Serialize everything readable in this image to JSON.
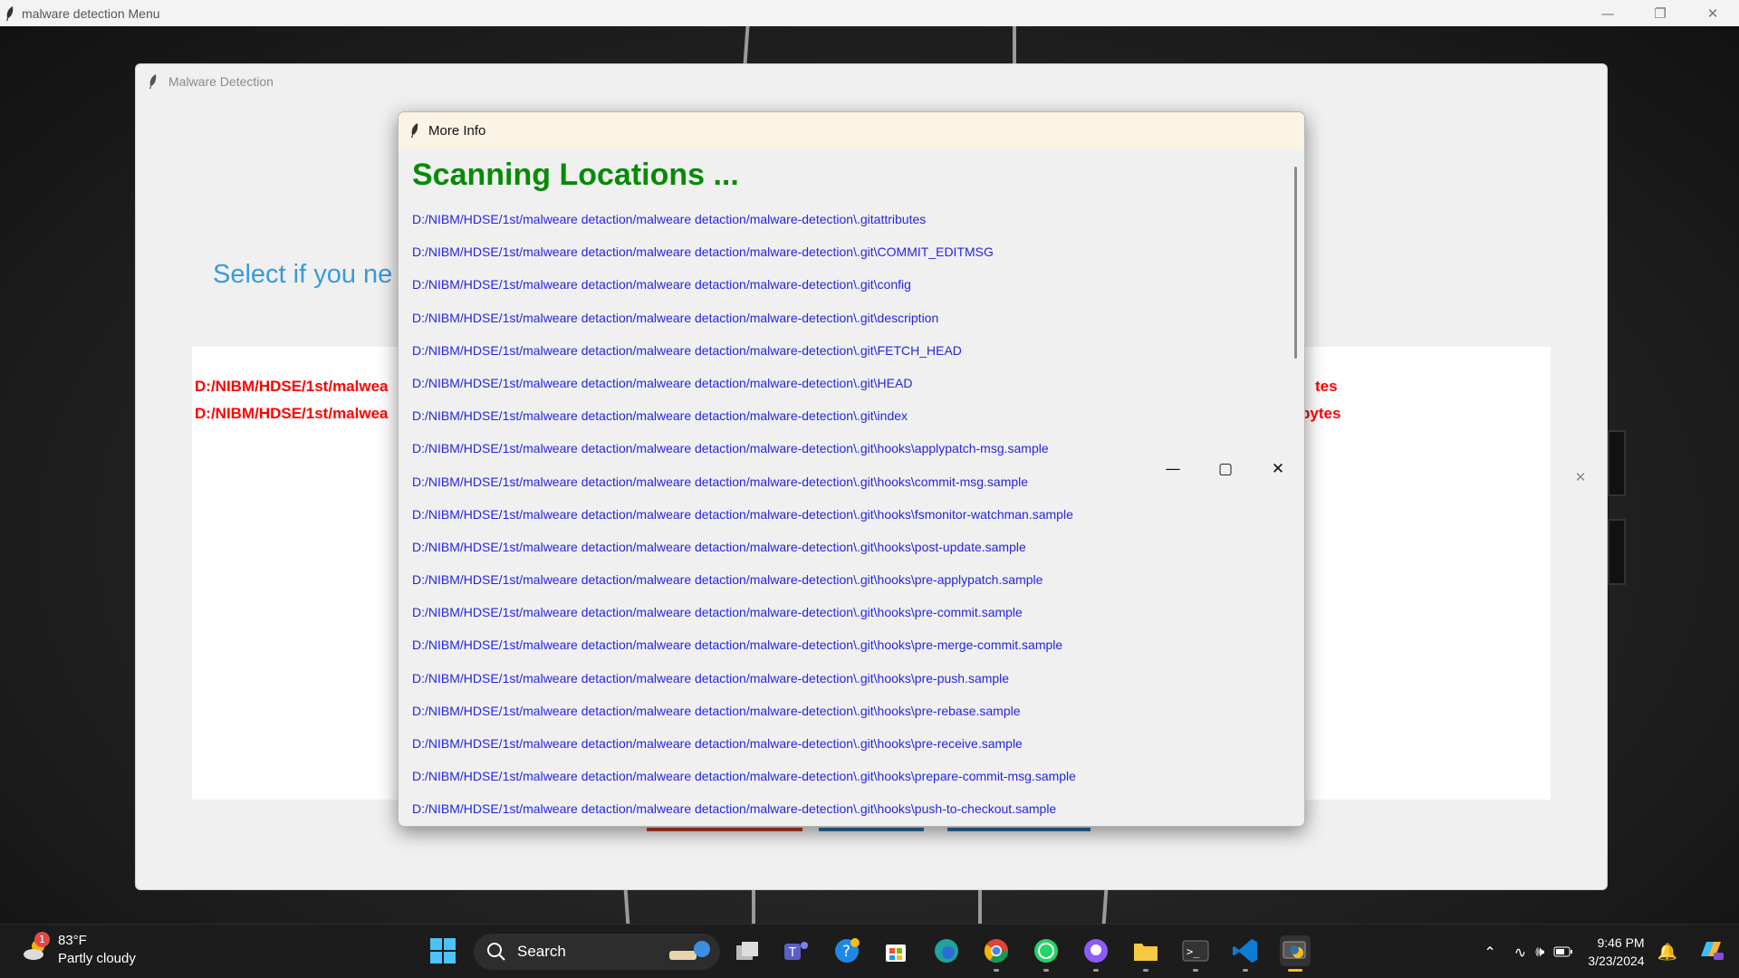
{
  "menu_window": {
    "title": "malware detection Menu"
  },
  "detection_window": {
    "title": "Malware Detection",
    "select_label": "Select if you ne",
    "results": [
      {
        "left": "D:/NIBM/HDSE/1st/malwea",
        "right": "tes"
      },
      {
        "left": "D:/NIBM/HDSE/1st/malwea",
        "right": "bytes"
      }
    ]
  },
  "info_window": {
    "title": "More Info",
    "heading": "Scanning Locations ...",
    "locations": [
      "D:/NIBM/HDSE/1st/malweare detaction/malweare detaction/malware-detection\\.gitattributes",
      "D:/NIBM/HDSE/1st/malweare detaction/malweare detaction/malware-detection\\.git\\COMMIT_EDITMSG",
      "D:/NIBM/HDSE/1st/malweare detaction/malweare detaction/malware-detection\\.git\\config",
      "D:/NIBM/HDSE/1st/malweare detaction/malweare detaction/malware-detection\\.git\\description",
      "D:/NIBM/HDSE/1st/malweare detaction/malweare detaction/malware-detection\\.git\\FETCH_HEAD",
      "D:/NIBM/HDSE/1st/malweare detaction/malweare detaction/malware-detection\\.git\\HEAD",
      "D:/NIBM/HDSE/1st/malweare detaction/malweare detaction/malware-detection\\.git\\index",
      "D:/NIBM/HDSE/1st/malweare detaction/malweare detaction/malware-detection\\.git\\hooks\\applypatch-msg.sample",
      "D:/NIBM/HDSE/1st/malweare detaction/malweare detaction/malware-detection\\.git\\hooks\\commit-msg.sample",
      "D:/NIBM/HDSE/1st/malweare detaction/malweare detaction/malware-detection\\.git\\hooks\\fsmonitor-watchman.sample",
      "D:/NIBM/HDSE/1st/malweare detaction/malweare detaction/malware-detection\\.git\\hooks\\post-update.sample",
      "D:/NIBM/HDSE/1st/malweare detaction/malweare detaction/malware-detection\\.git\\hooks\\pre-applypatch.sample",
      "D:/NIBM/HDSE/1st/malweare detaction/malweare detaction/malware-detection\\.git\\hooks\\pre-commit.sample",
      "D:/NIBM/HDSE/1st/malweare detaction/malweare detaction/malware-detection\\.git\\hooks\\pre-merge-commit.sample",
      "D:/NIBM/HDSE/1st/malweare detaction/malweare detaction/malware-detection\\.git\\hooks\\pre-push.sample",
      "D:/NIBM/HDSE/1st/malweare detaction/malweare detaction/malware-detection\\.git\\hooks\\pre-rebase.sample",
      "D:/NIBM/HDSE/1st/malweare detaction/malweare detaction/malware-detection\\.git\\hooks\\pre-receive.sample",
      "D:/NIBM/HDSE/1st/malweare detaction/malweare detaction/malware-detection\\.git\\hooks\\prepare-commit-msg.sample",
      "D:/NIBM/HDSE/1st/malweare detaction/malweare detaction/malware-detection\\.git\\hooks\\push-to-checkout.sample"
    ]
  },
  "taskbar": {
    "weather_temp": "83°F",
    "weather_desc": "Partly cloudy",
    "weather_badge": "1",
    "search_label": "Search",
    "time": "9:46 PM",
    "date": "3/23/2024"
  },
  "colors": {
    "heading_green": "#078a07",
    "location_blue": "#2525e0",
    "result_red": "#ff0000",
    "select_blue": "#3a9ad9"
  }
}
